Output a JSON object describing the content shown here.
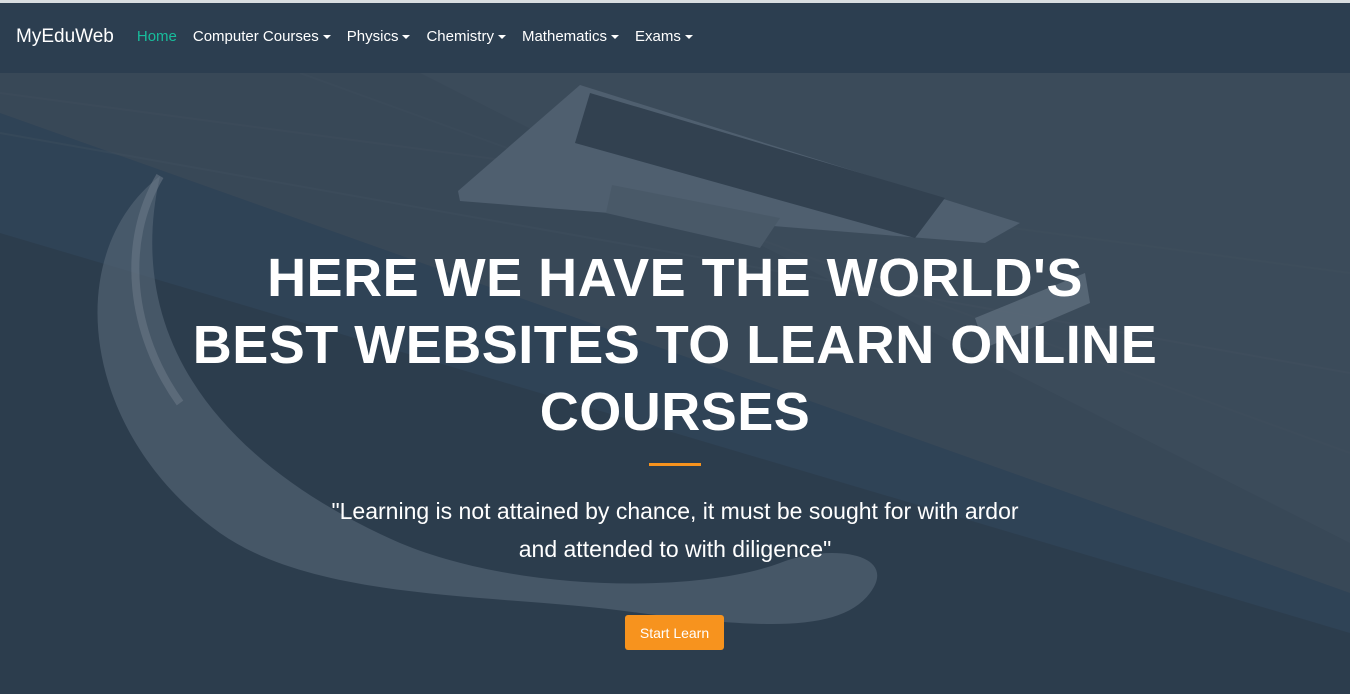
{
  "navbar": {
    "brand": "MyEduWeb",
    "items": [
      {
        "label": "Home",
        "active": true,
        "dropdown": false
      },
      {
        "label": "Computer Courses",
        "active": false,
        "dropdown": true
      },
      {
        "label": "Physics",
        "active": false,
        "dropdown": true
      },
      {
        "label": "Chemistry",
        "active": false,
        "dropdown": true
      },
      {
        "label": "Mathematics",
        "active": false,
        "dropdown": true
      },
      {
        "label": "Exams",
        "active": false,
        "dropdown": true
      }
    ]
  },
  "hero": {
    "heading_line1": "HERE WE HAVE THE WORLD'S",
    "heading_line2": "BEST WEBSITES TO LEARN ONLINE",
    "heading_line3": "COURSES",
    "quote_line1": "\"Learning is not attained by chance, it must be sought for with ardor",
    "quote_line2": "and attended to with diligence\"",
    "button_label": "Start Learn"
  },
  "colors": {
    "navbar_bg": "#2c3e50",
    "accent_active": "#18bc9c",
    "accent_orange": "#f7931e",
    "text": "#ffffff"
  },
  "icons": {
    "dropdown": "caret-down-icon",
    "background_image": "laptop-on-desk-photo"
  }
}
